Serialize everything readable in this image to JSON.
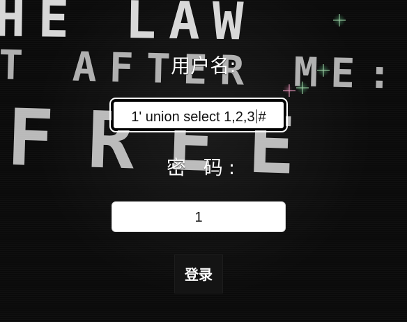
{
  "form": {
    "username_label": "用户名:",
    "username_value_before_caret": "1' union select 1,2,3",
    "username_value_after_caret": "#",
    "password_label": "密 码:",
    "password_value": "1",
    "login_button_label": "登录"
  },
  "background": {
    "line_1": "HE LAW",
    "line_2": "T AFTER ME:",
    "line_3": "FREE"
  }
}
